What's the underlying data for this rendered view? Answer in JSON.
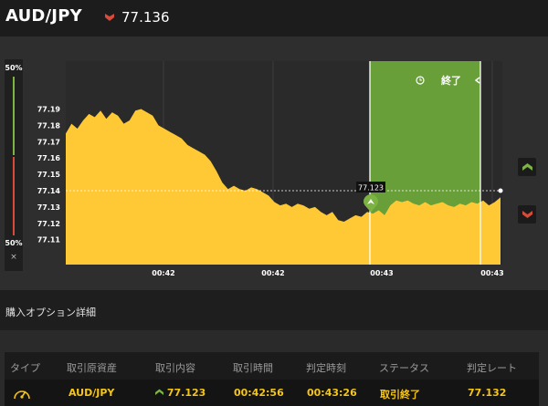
{
  "header": {
    "pair": "AUD/JPY",
    "price": "77.136",
    "direction_icon": "down-arrow-icon",
    "down_color": "#d84a3a"
  },
  "gauge": {
    "top_pct": "50%",
    "bottom_pct": "50%",
    "close_label": "×"
  },
  "chart_data": {
    "type": "area",
    "y_ticks": [
      "77.19",
      "77.18",
      "77.17",
      "77.16",
      "77.15",
      "77.14",
      "77.13",
      "77.12",
      "77.11"
    ],
    "x_ticks": [
      "00:42",
      "00:42",
      "00:43",
      "00:43"
    ],
    "ylim": [
      77.1,
      77.2
    ],
    "values": [
      77.175,
      77.181,
      77.178,
      77.183,
      77.187,
      77.185,
      77.189,
      77.184,
      77.188,
      77.186,
      77.181,
      77.183,
      77.189,
      77.19,
      77.188,
      77.186,
      77.18,
      77.178,
      77.176,
      77.174,
      77.172,
      77.168,
      77.166,
      77.164,
      77.162,
      77.158,
      77.152,
      77.145,
      77.141,
      77.143,
      77.141,
      77.14,
      77.142,
      77.141,
      77.139,
      77.137,
      77.133,
      77.131,
      77.132,
      77.13,
      77.132,
      77.131,
      77.129,
      77.13,
      77.127,
      77.125,
      77.127,
      77.122,
      77.121,
      77.123,
      77.125,
      77.124,
      77.127,
      77.126,
      77.128,
      77.125,
      77.131,
      77.134,
      77.133,
      77.134,
      77.132,
      77.131,
      77.133,
      77.131,
      77.132,
      77.133,
      77.131,
      77.13,
      77.132,
      77.131,
      77.133,
      77.132,
      77.134,
      77.131,
      77.133,
      77.136
    ],
    "area_color": "#ffc935",
    "entry_rate": "77.123",
    "entry_color": "#7cb342",
    "current_rate": "77.136",
    "expiry_label": "終了",
    "expiry_color": "#689f38"
  },
  "details": {
    "title": "購入オプション詳細",
    "columns": [
      "タイプ",
      "取引原資産",
      "取引内容",
      "取引時間",
      "判定時刻",
      "ステータス",
      "判定レート"
    ],
    "row": {
      "type_icon": "gauge-icon",
      "asset": "AUD/JPY",
      "content": "77.123",
      "content_icon": "up-arrow-icon",
      "trade_time": "00:42:56",
      "judge_time": "00:43:26",
      "status": "取引終了",
      "judge_rate": "77.132"
    }
  }
}
